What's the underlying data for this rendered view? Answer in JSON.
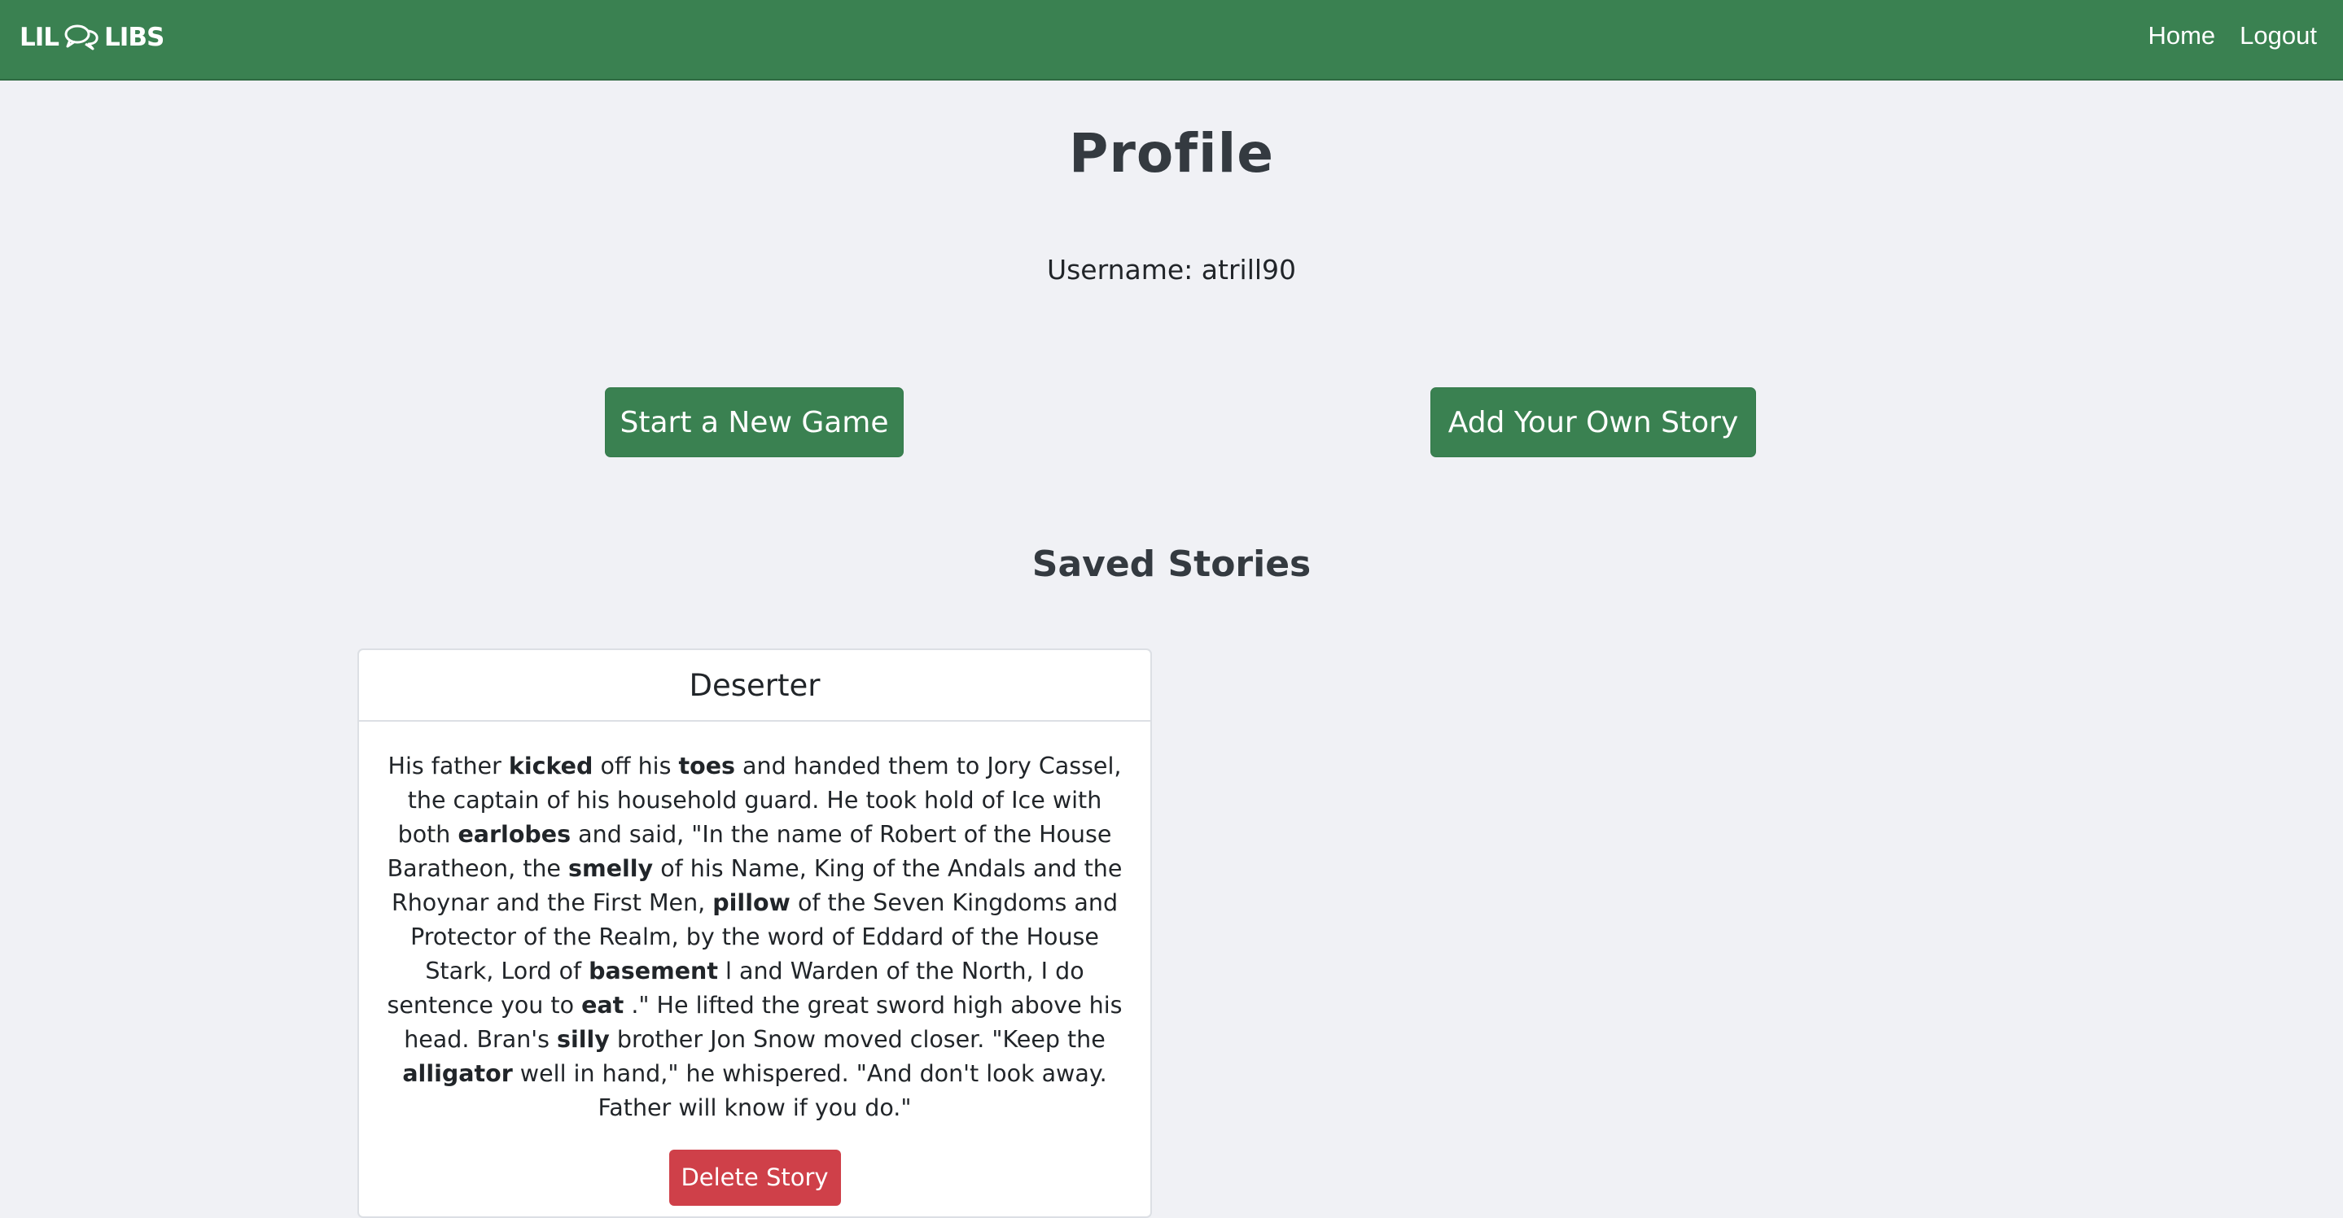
{
  "navbar": {
    "brand_left": "LIL",
    "brand_right": "LIBS",
    "brand_icon": "chat-bubbles-icon",
    "links": [
      "Home",
      "Logout"
    ]
  },
  "profile": {
    "title": "Profile",
    "username_label": "Username:",
    "username_value": "atrill90"
  },
  "actions": {
    "start_game": "Start a New Game",
    "add_story": "Add Your Own Story"
  },
  "saved": {
    "title": "Saved Stories",
    "stories": [
      {
        "title": "Deserter",
        "segments": [
          {
            "t": "His father ",
            "b": false
          },
          {
            "t": "kicked",
            "b": true
          },
          {
            "t": " off his ",
            "b": false
          },
          {
            "t": "toes",
            "b": true
          },
          {
            "t": " and handed them to Jory Cassel, the captain of his household guard. He took hold of Ice with both ",
            "b": false
          },
          {
            "t": "earlobes",
            "b": true
          },
          {
            "t": " and said, \"In the name of Robert of the House Baratheon, the ",
            "b": false
          },
          {
            "t": "smelly",
            "b": true
          },
          {
            "t": " of his Name, King of the Andals and the Rhoynar and the First Men, ",
            "b": false
          },
          {
            "t": "pillow",
            "b": true
          },
          {
            "t": " of the Seven Kingdoms and Protector of the Realm, by the word of Eddard of the House Stark, Lord of ",
            "b": false
          },
          {
            "t": "basement",
            "b": true
          },
          {
            "t": " l and Warden of the North, I do sentence you to ",
            "b": false
          },
          {
            "t": "eat",
            "b": true
          },
          {
            "t": " .\" He lifted the great sword high above his head. Bran's ",
            "b": false
          },
          {
            "t": "silly",
            "b": true
          },
          {
            "t": " brother Jon Snow moved closer. \"Keep the ",
            "b": false
          },
          {
            "t": "alligator",
            "b": true
          },
          {
            "t": " well in hand,\" he whispered. \"And don't look away. Father will know if you do.\"",
            "b": false
          }
        ],
        "delete_label": "Delete Story"
      }
    ]
  },
  "colors": {
    "brand_green": "#3a8151",
    "danger_red": "#cf4049",
    "page_bg": "#f0f1f5"
  }
}
